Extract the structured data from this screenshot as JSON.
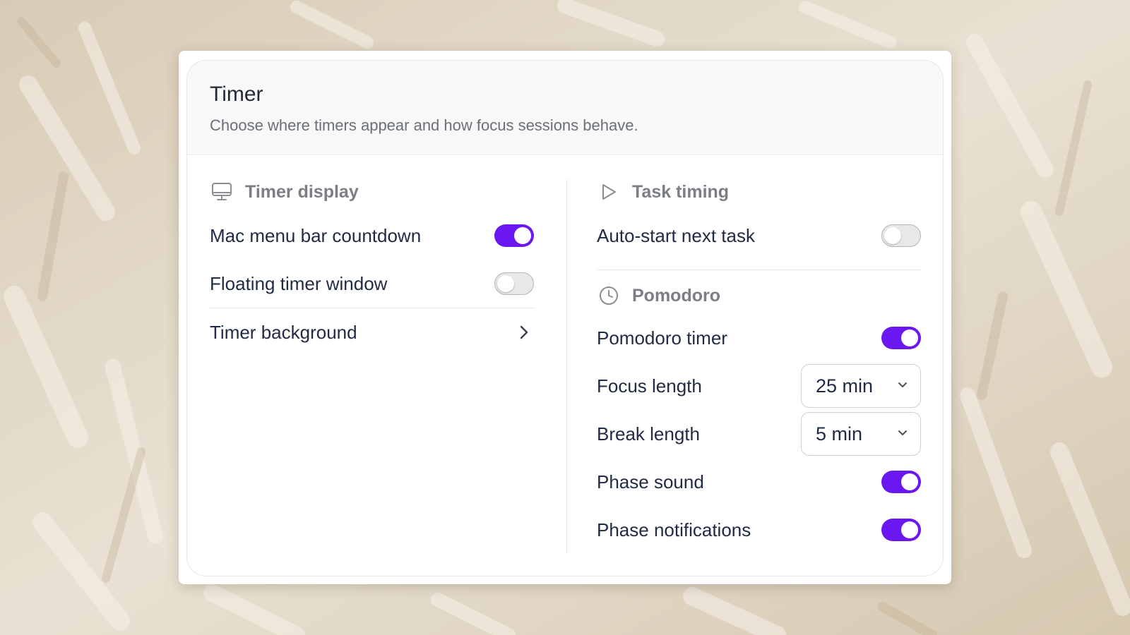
{
  "panel": {
    "title": "Timer",
    "subtitle": "Choose where timers appear and how focus sessions behave."
  },
  "timer_display": {
    "heading": "Timer display",
    "icon": "monitor-icon",
    "items": [
      {
        "label": "Mac menu bar countdown",
        "on": true
      },
      {
        "label": "Floating timer window",
        "on": false
      }
    ],
    "background_label": "Timer background"
  },
  "task_timing": {
    "heading": "Task timing",
    "icon": "play-icon",
    "auto_start": {
      "label": "Auto-start next task",
      "on": false
    }
  },
  "pomodoro": {
    "heading": "Pomodoro",
    "icon": "clock-icon",
    "timer": {
      "label": "Pomodoro timer",
      "on": true
    },
    "focus_length": {
      "label": "Focus length",
      "value": "25 min"
    },
    "break_length": {
      "label": "Break length",
      "value": "5 min"
    },
    "phase_sound": {
      "label": "Phase sound",
      "on": true
    },
    "phase_notifications": {
      "label": "Phase notifications",
      "on": true
    }
  },
  "colors": {
    "accent": "#6b17f2",
    "text_primary": "#1f2a44",
    "text_muted": "#7b7e85"
  }
}
